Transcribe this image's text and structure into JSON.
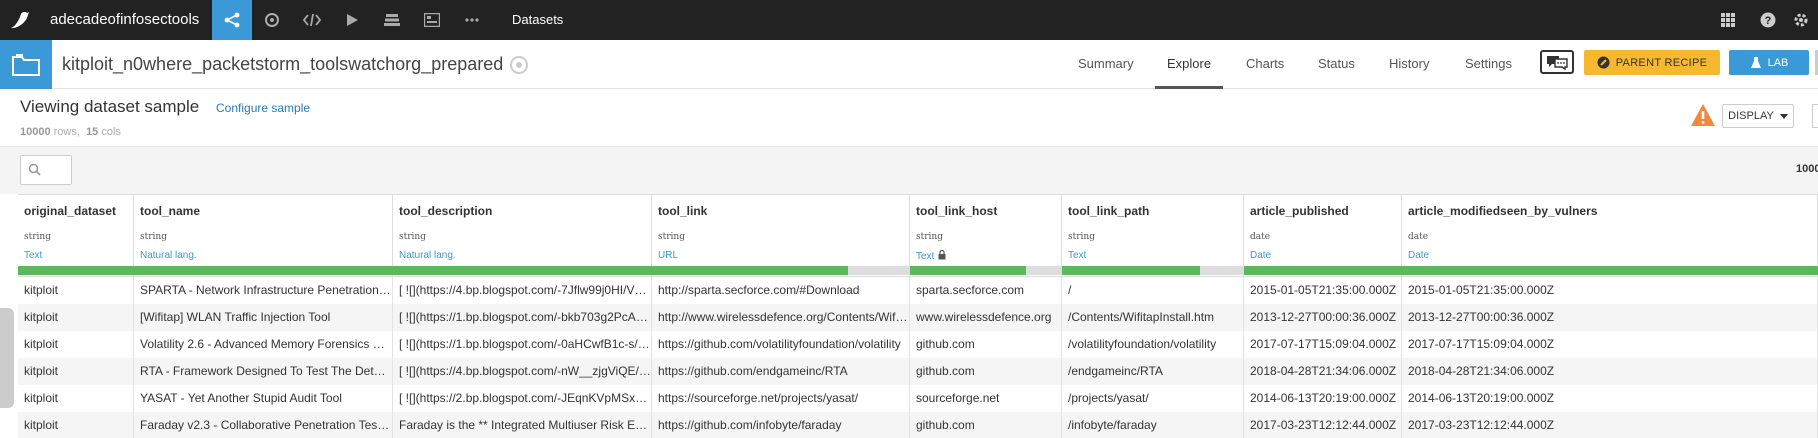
{
  "topnav": {
    "project": "adecadeofinfosectools",
    "section": "Datasets",
    "icons": [
      "flow-icon",
      "recycle-icon",
      "code-icon",
      "play-icon",
      "stack-icon",
      "dashboard-icon",
      "more-icon"
    ],
    "right_icons": [
      "apps-grid-icon",
      "help-icon",
      "settings-icon"
    ]
  },
  "dataset": {
    "name": "kitploit_n0where_packetstorm_toolswatchorg_prepared",
    "tabs": [
      "Summary",
      "Explore",
      "Charts",
      "Status",
      "History",
      "Settings"
    ],
    "active_tab": "Explore",
    "parent_recipe_label": "PARENT RECIPE",
    "lab_label": "LAB"
  },
  "sample": {
    "title": "Viewing dataset sample",
    "configure_label": "Configure sample",
    "rows": "10000",
    "rows_unit": "rows,",
    "cols": "15",
    "cols_unit": "cols",
    "display_label": "DISPLAY",
    "count_text": "1000"
  },
  "colors": {
    "accent": "#3b99d8",
    "parent_recipe": "#f5b82e",
    "valid": "#5cb85c",
    "warning": "#f0883e"
  },
  "table": {
    "columns": [
      {
        "name": "original_dataset",
        "storage": "string",
        "meaning": "Text",
        "valid": 1.0
      },
      {
        "name": "tool_name",
        "storage": "string",
        "meaning": "Natural lang.",
        "valid": 1.0
      },
      {
        "name": "tool_description",
        "storage": "string",
        "meaning": "Natural lang.",
        "valid": 1.0
      },
      {
        "name": "tool_link",
        "storage": "string",
        "meaning": "URL",
        "valid": 0.76
      },
      {
        "name": "tool_link_host",
        "storage": "string",
        "meaning": "Text",
        "valid": 0.76
      },
      {
        "name": "tool_link_path",
        "storage": "string",
        "meaning": "Text",
        "valid": 0.76
      },
      {
        "name": "article_published",
        "storage": "date",
        "meaning": "Date",
        "valid": 1.0
      },
      {
        "name": "article_modifiedseen_by_vulners",
        "storage": "date",
        "meaning": "Date",
        "valid": 1.0
      }
    ],
    "rows": [
      [
        "kitploit",
        "SPARTA - Network Infrastructure Penetration Testin...",
        "[ ![](https://4.bp.blogspot.com/-7Jflw99j0HI/VKnp5...",
        "http://sparta.secforce.com/#Download",
        "sparta.secforce.com",
        "/",
        "2015-01-05T21:35:00.000Z",
        "2015-01-05T21:35:00.000Z"
      ],
      [
        "kitploit",
        "[Wifitap] WLAN Traffic Injection Tool",
        "[ ![](https://1.bp.blogspot.com/-bkb703g2PcA/Urz...",
        "http://www.wirelessdefence.org/Contents/Wifitapl...",
        "www.wirelessdefence.org",
        "/Contents/WifitapInstall.htm",
        "2013-12-27T00:00:36.000Z",
        "2013-12-27T00:00:36.000Z"
      ],
      [
        "kitploit",
        "Volatility 2.6 - Advanced Memory Forensics Framew...",
        "[ ![](https://1.bp.blogspot.com/-0aHCwfB1c-s/WWe...",
        "https://github.com/volatilityfoundation/volatility",
        "github.com",
        "/volatilityfoundation/volatility",
        "2017-07-17T15:09:04.000Z",
        "2017-07-17T15:09:04.000Z"
      ],
      [
        "kitploit",
        "RTA - Framework Designed To Test The Detection C...",
        "[ ![](https://4.bp.blogspot.com/-nW__zjgViQE/WuA...",
        "https://github.com/endgameinc/RTA",
        "github.com",
        "/endgameinc/RTA",
        "2018-04-28T21:34:06.000Z",
        "2018-04-28T21:34:06.000Z"
      ],
      [
        "kitploit",
        "YASAT - Yet Another Stupid Audit Tool",
        "[ ![](https://2.bp.blogspot.com/-JEqnKVpMSxA/U5...",
        "https://sourceforge.net/projects/yasat/",
        "sourceforge.net",
        "/projects/yasat/",
        "2014-06-13T20:19:00.000Z",
        "2014-06-13T20:19:00.000Z"
      ],
      [
        "kitploit",
        "Faraday v2.3 - Collaborative Penetration Test and V...",
        "Faraday is the  ** Integrated Multiuser Risk Environ...",
        "https://github.com/infobyte/faraday",
        "github.com",
        "/infobyte/faraday",
        "2017-03-23T12:12:44.000Z",
        "2017-03-23T12:12:44.000Z"
      ]
    ]
  }
}
